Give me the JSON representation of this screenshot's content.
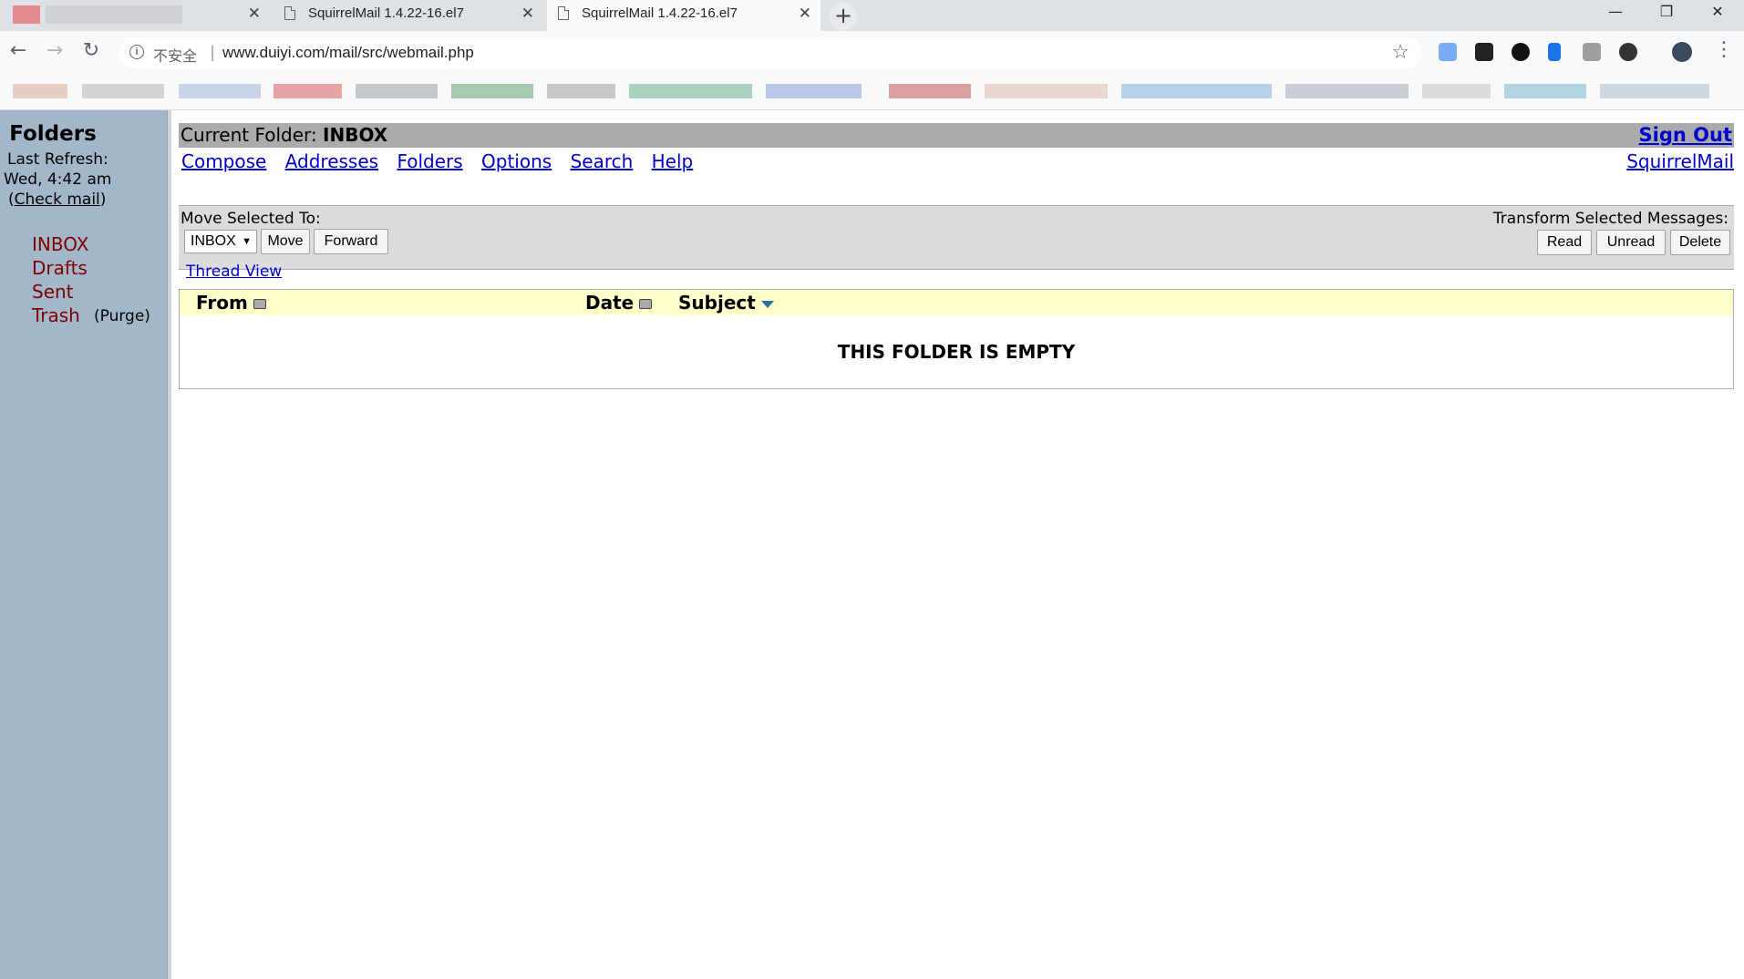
{
  "browser": {
    "tabs": [
      {
        "title": "",
        "blurred": true
      },
      {
        "title": "SquirrelMail 1.4.22-16.el7"
      },
      {
        "title": "SquirrelMail 1.4.22-16.el7",
        "active": true
      }
    ],
    "tab_close_glyph": "✕",
    "new_tab_glyph": "+",
    "security_label": "不安全",
    "url": "www.duiyi.com/mail/src/webmail.php"
  },
  "sidebar": {
    "title": "Folders",
    "last_refresh_label": "Last Refresh:",
    "last_refresh_time": "Wed, 4:42 am",
    "check_mail_open": "(",
    "check_mail": "Check mail",
    "check_mail_close": ")",
    "folders": [
      "INBOX",
      "Drafts",
      "Sent",
      "Trash"
    ],
    "purge": "(Purge)",
    "folder_color": "#800000"
  },
  "header": {
    "current_folder_label": "Current Folder: ",
    "current_folder": "INBOX",
    "sign_out": "Sign Out",
    "nav": [
      "Compose",
      "Addresses",
      "Folders",
      "Options",
      "Search",
      "Help"
    ],
    "squirrelmail_link": "SquirrelMail"
  },
  "actions": {
    "move_label": "Move Selected To:",
    "move_target": "INBOX",
    "move_button": "Move",
    "forward_button": "Forward",
    "transform_label": "Transform Selected Messages:",
    "read_button": "Read",
    "unread_button": "Unread",
    "delete_button": "Delete",
    "thread_view": "Thread View"
  },
  "messages": {
    "columns": [
      "From",
      "Date",
      "Subject"
    ],
    "empty_text": "THIS FOLDER IS EMPTY"
  },
  "colors": {
    "sidebar_bg": "#a2b8ca",
    "link": "#0000cc",
    "header_bar": "#ababab",
    "table_header": "#ffffcc"
  }
}
